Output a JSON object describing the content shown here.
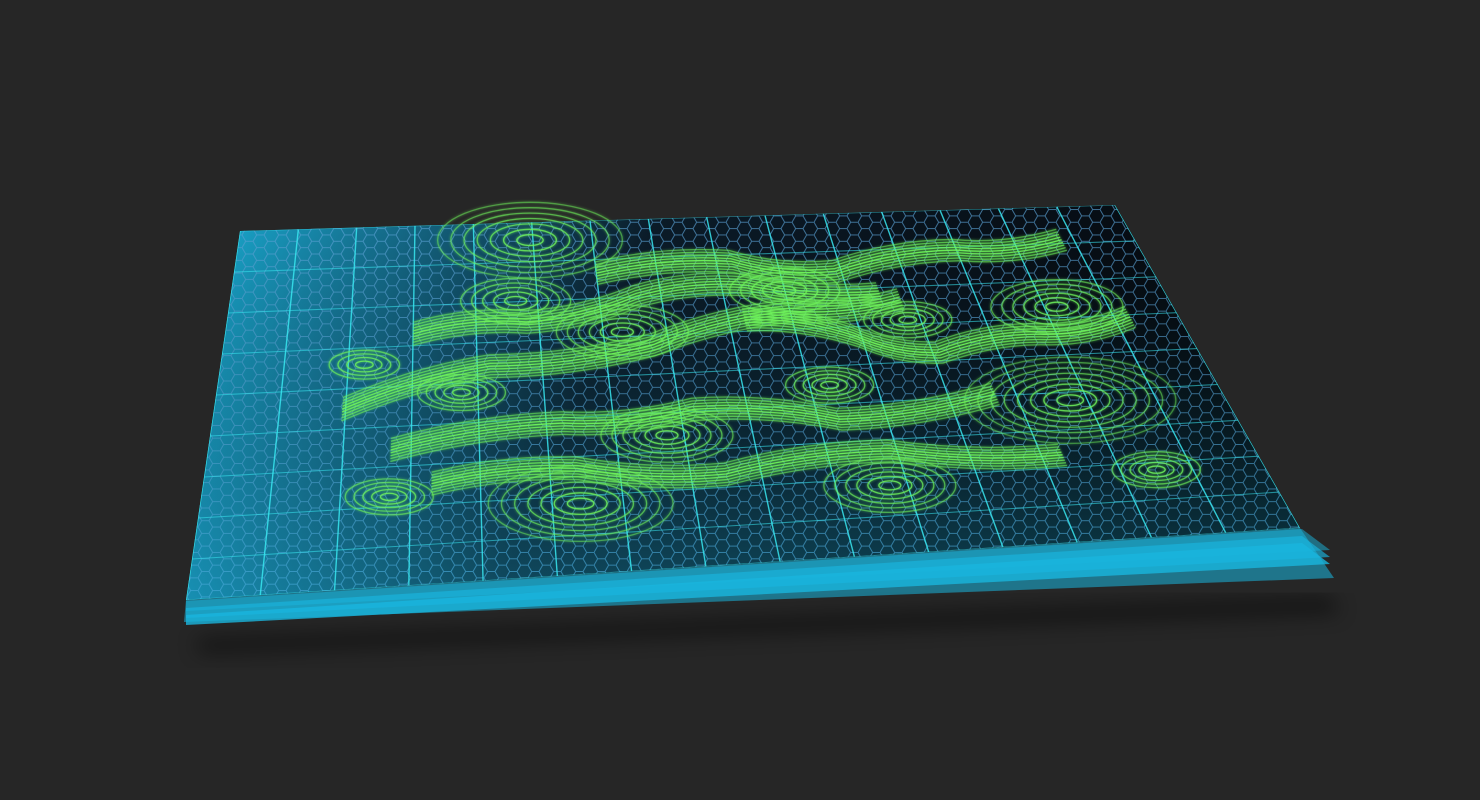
{
  "scene": {
    "background": "#262626",
    "plate_colors": {
      "top_edge": "#0a0f16",
      "cyan_edge": "#1ab6de",
      "grid_line": "#38e6f0",
      "hex_stroke": "#5aa2d6"
    },
    "pattern_color": "#6ef25a",
    "layers": 3,
    "icons": {
      "plate": "hex-grid-plate-icon",
      "pattern": "contour-flow-icon"
    }
  }
}
